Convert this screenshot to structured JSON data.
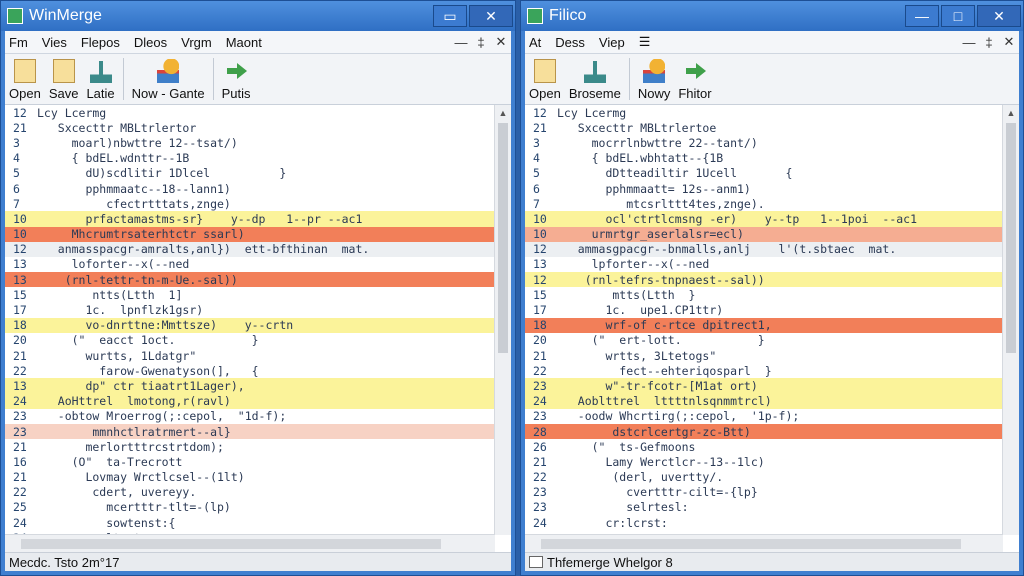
{
  "left": {
    "title": "WinMerge",
    "menu": [
      "Fm",
      "Vies",
      "Flepos",
      "Dleos",
      "Vrgm",
      "Maont"
    ],
    "toolbar": [
      {
        "label": "Open",
        "icon": "open-file-icon"
      },
      {
        "label": "Save",
        "icon": "save-file-icon"
      },
      {
        "label": "Latie",
        "icon": "merge-icon"
      },
      {
        "label": "Now - Gante",
        "icon": "bulb-icon"
      },
      {
        "label": "Putis",
        "icon": "arrow-right-icon"
      }
    ],
    "lines": [
      {
        "n": "12",
        "t": "Lcy Lcermg",
        "hl": ""
      },
      {
        "n": "21",
        "t": "   Sxcecttr MBLtrlertor",
        "hl": ""
      },
      {
        "n": "3",
        "t": "     moarl)nbwttre 12--tsat/)",
        "hl": ""
      },
      {
        "n": "4",
        "t": "     { bdEL.wdnttr--1B",
        "hl": ""
      },
      {
        "n": "5",
        "t": "       dU)scdlitir 1Dlcel          }",
        "hl": ""
      },
      {
        "n": "6",
        "t": "       pphmmaatc--18--lann1)",
        "hl": ""
      },
      {
        "n": "7",
        "t": "          cfectrtttats,znge)",
        "hl": ""
      },
      {
        "n": "10",
        "t": "       prfactamastms-sr}    y--dp   1--pr --ac1",
        "hl": "y"
      },
      {
        "n": "10",
        "t": "     Mhcrumtrsaterhtctr ssarl)",
        "hl": "r"
      },
      {
        "n": "12",
        "t": "   anmasspacgr-amralts,anl})  ett-bfthinan  mat.",
        "hl": "g"
      },
      {
        "n": "13",
        "t": "     loforter--x(--ned",
        "hl": ""
      },
      {
        "n": "13",
        "t": "    (rnl-tettr-tn-m-Ue.-sal))",
        "hl": "r"
      },
      {
        "n": "15",
        "t": "        ntts(Ltth  1]",
        "hl": ""
      },
      {
        "n": "17",
        "t": "       1c.  lpnflzk1gsr)",
        "hl": ""
      },
      {
        "n": "18",
        "t": "       vo-dnrttne:Mmttsze)    y--crtn",
        "hl": "y"
      },
      {
        "n": "20",
        "t": "     (\"  eacct 1oct.           }",
        "hl": ""
      },
      {
        "n": "21",
        "t": "       wurtts, 1Ldatgr\"",
        "hl": ""
      },
      {
        "n": "22",
        "t": "         farow-Gwenatyson(],   {",
        "hl": ""
      },
      {
        "n": "13",
        "t": "       dp\" ctr tiaatrt1Lager),",
        "hl": "y"
      },
      {
        "n": "24",
        "t": "   AoHttrel  lmotong,r(ravl)",
        "hl": "y"
      },
      {
        "n": "23",
        "t": "   -obtow Mroerrog(;:cepol,  \"1d-f);",
        "hl": ""
      },
      {
        "n": "23",
        "t": "        mmnhctlratrmert--al}",
        "hl": "p"
      },
      {
        "n": "21",
        "t": "       merlortttrcstrtdom);",
        "hl": ""
      },
      {
        "n": "16",
        "t": "     (O\"  ta-Trecrott",
        "hl": ""
      },
      {
        "n": "21",
        "t": "       Lovmay Wrctlcsel--(1lt)",
        "hl": ""
      },
      {
        "n": "22",
        "t": "        cdert, uvereyy.",
        "hl": ""
      },
      {
        "n": "25",
        "t": "          mcertttr-tlt=-(lp)",
        "hl": ""
      },
      {
        "n": "24",
        "t": "          sowtenst:{",
        "hl": ""
      },
      {
        "n": "24",
        "t": "       cerltect:",
        "hl": ""
      }
    ],
    "status": "Mecdc.  Tsto    2m°17"
  },
  "right": {
    "title": "Filico",
    "menu": [
      "At",
      "Dess",
      "Viep",
      "☰"
    ],
    "toolbar": [
      {
        "label": "Open",
        "icon": "open-file-icon"
      },
      {
        "label": "Broseme",
        "icon": "merge-icon"
      },
      {
        "label": "Nowy",
        "icon": "bulb-icon"
      },
      {
        "label": "Fhitor",
        "icon": "arrow-right-icon"
      }
    ],
    "lines": [
      {
        "n": "12",
        "t": "Lcy Lcermg",
        "hl": ""
      },
      {
        "n": "21",
        "t": "   Sxcecttr MBLtrlertoe",
        "hl": ""
      },
      {
        "n": "3",
        "t": "     mocrrlnbwttre 22--tant/)",
        "hl": ""
      },
      {
        "n": "4",
        "t": "     { bdEL.wbhtatt--{1B",
        "hl": ""
      },
      {
        "n": "5",
        "t": "       dDtteadiltir 1Ucell       {",
        "hl": ""
      },
      {
        "n": "6",
        "t": "       pphmmaatt= 12s--anm1)",
        "hl": ""
      },
      {
        "n": "7",
        "t": "          mtcsrlttt4tes,znge).",
        "hl": ""
      },
      {
        "n": "10",
        "t": "       ocl'ctrtlcmsng -er)    y--tp   1--1poi  --ac1",
        "hl": "y"
      },
      {
        "n": "10",
        "t": "     urmrtgr_aserlalsr=ecl)",
        "hl": "o"
      },
      {
        "n": "12",
        "t": "   ammasgpacgr--bnmalls,anlj    l'(t.sbtaec  mat.",
        "hl": "g"
      },
      {
        "n": "13",
        "t": "     lpforter--x(--ned",
        "hl": ""
      },
      {
        "n": "12",
        "t": "    (rnl-tefrs-tnpnaest--sal))",
        "hl": "y"
      },
      {
        "n": "15",
        "t": "        mtts(Ltth  }",
        "hl": ""
      },
      {
        "n": "17",
        "t": "       1c.  upe1.CP1ttr)",
        "hl": ""
      },
      {
        "n": "18",
        "t": "       wrf-of c-rtce dpitrect1,",
        "hl": "r"
      },
      {
        "n": "20",
        "t": "     (\"  ert-lott.           }",
        "hl": ""
      },
      {
        "n": "21",
        "t": "       wrtts, 3Ltetogs\"",
        "hl": ""
      },
      {
        "n": "22",
        "t": "         fect--ehteriqosparl  }",
        "hl": ""
      },
      {
        "n": "23",
        "t": "       w\"-tr-fcotr-[M1at ort)",
        "hl": "y"
      },
      {
        "n": "24",
        "t": "   Aoblttrel  lttttnlsqnmmtrcl)",
        "hl": "y"
      },
      {
        "n": "23",
        "t": "   -oodw Whcrtirg(;:cepol,  '1p-f);",
        "hl": ""
      },
      {
        "n": "28",
        "t": "        dstcrlcertgr-zc-Btt)",
        "hl": "r"
      },
      {
        "n": "26",
        "t": "     (\"  ts-Gefmoons",
        "hl": ""
      },
      {
        "n": "21",
        "t": "       Lamy Werctlcr--13--1lc)",
        "hl": ""
      },
      {
        "n": "22",
        "t": "        (derl, uvertty/.",
        "hl": ""
      },
      {
        "n": "23",
        "t": "          cvertttr-cilt=-{lp}",
        "hl": ""
      },
      {
        "n": "23",
        "t": "          selrtesl:",
        "hl": ""
      },
      {
        "n": "24",
        "t": "       cr:lcrst:",
        "hl": ""
      }
    ],
    "status": "Thfemerge Whelgor 8"
  }
}
